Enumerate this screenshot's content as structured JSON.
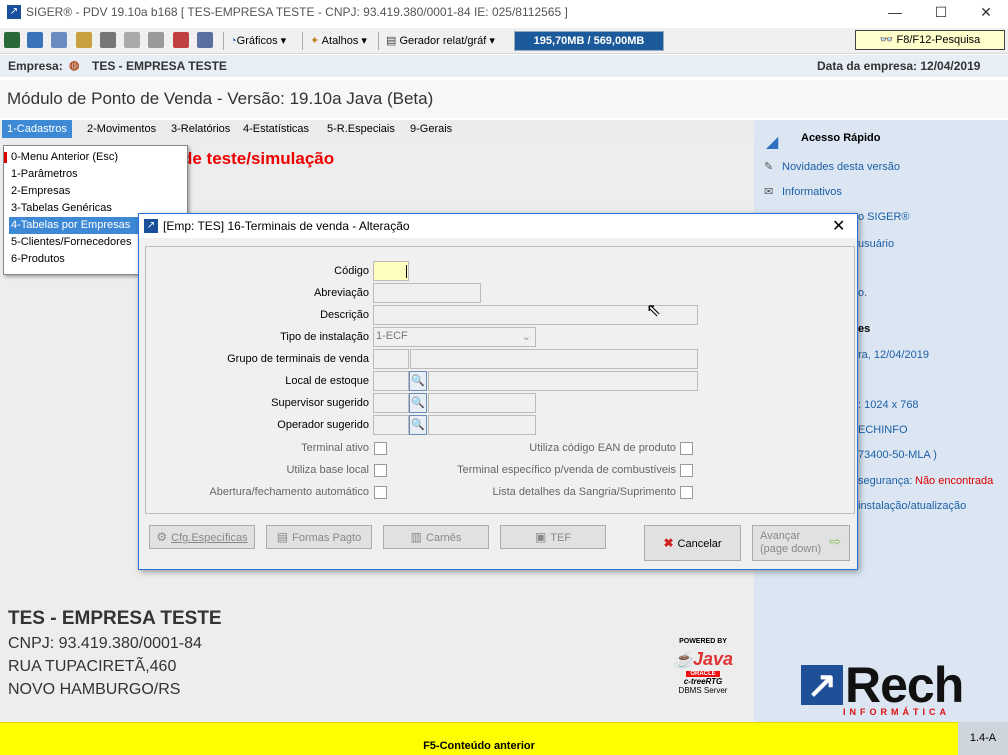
{
  "window": {
    "title": "SIGER® - PDV 19.10a b168 [ TES-EMPRESA TESTE - CNPJ: 93.419.380/0001-84 IE: 025/8112565 ]"
  },
  "toolbar": {
    "graficos": "Gráficos",
    "atalhos": "Atalhos",
    "gerador": "Gerador relat/gráf",
    "memory": "195,70MB / 569,00MB",
    "search_btn": "F8/F12-Pesquisa"
  },
  "infobar": {
    "empresa_label": "Empresa:",
    "empresa": "TES - EMPRESA TESTE",
    "data_empresa": "Data da empresa: 12/04/2019"
  },
  "module_title": "Módulo de Ponto de Venda - Versão: 19.10a Java (Beta)",
  "menubar": [
    "1-Cadastros",
    "2-Movimentos",
    "3-Relatórios",
    "4-Estatísticas",
    "5-R.Especiais",
    "9-Gerais"
  ],
  "dropdown": [
    "0-Menu Anterior (Esc)",
    "1-Parâmetros",
    "2-Empresas",
    "3-Tabelas Genéricas",
    "4-Tabelas por Empresas",
    "5-Clientes/Fornecedores",
    "6-Produtos"
  ],
  "banner": "de teste/simulação",
  "dialog": {
    "title": "[Emp: TES] 16-Terminais de venda - Alteração",
    "labels": {
      "codigo": "Código",
      "abreviacao": "Abreviação",
      "descricao": "Descrição",
      "tipo": "Tipo de instalação",
      "grupo": "Grupo de terminais de venda",
      "local": "Local de estoque",
      "supervisor": "Supervisor sugerido",
      "operador": "Operador sugerido"
    },
    "tipo_value": "1-ECF",
    "checks_left": [
      "Terminal ativo",
      "Utiliza base local",
      "Abertura/fechamento automático"
    ],
    "checks_right": [
      "Utiliza código EAN de produto",
      "Terminal específico p/venda de combustíveis",
      "Lista detalhes da Sangria/Suprimento"
    ],
    "buttons": {
      "cfg": "Cfg.Específicas",
      "formas": "Formas Pagto",
      "carnes": "Carnês",
      "tef": "TEF",
      "cancelar": "Cancelar",
      "avancar": "Avançar",
      "avancar_sub": "(page down)"
    }
  },
  "right": {
    "acesso": "Acesso Rápido",
    "novidades": "Novidades desta versão",
    "informativos": "Informativos",
    "siger": "o SIGER®",
    "usuario": "usuário",
    "dot": "o.",
    "es": "es",
    "data": "ra, 12/04/2019",
    "res": ": 1024 x 768",
    "host": "ECHINFO",
    "mla": "73400-50-MLA )",
    "seg_label": "segurança:",
    "seg_value": "Não encontrada",
    "inst": "instalação/atualização"
  },
  "company": {
    "name": "TES - EMPRESA TESTE",
    "cnpj": "CNPJ: 93.419.380/0001-84",
    "street": "RUA TUPACIRETÃ,460",
    "city": "NOVO HAMBURGO/RS"
  },
  "powered": {
    "by": "POWERED BY",
    "java": "Java",
    "oracle": "ORACLE",
    "ctree": "c-treeRTG",
    "dbms": "DBMS Server"
  },
  "logo": {
    "rech": "Rech",
    "informatica": "INFORMÁTICA"
  },
  "status": {
    "text": "F5-Conteúdo anterior",
    "version": "1.4-A"
  }
}
